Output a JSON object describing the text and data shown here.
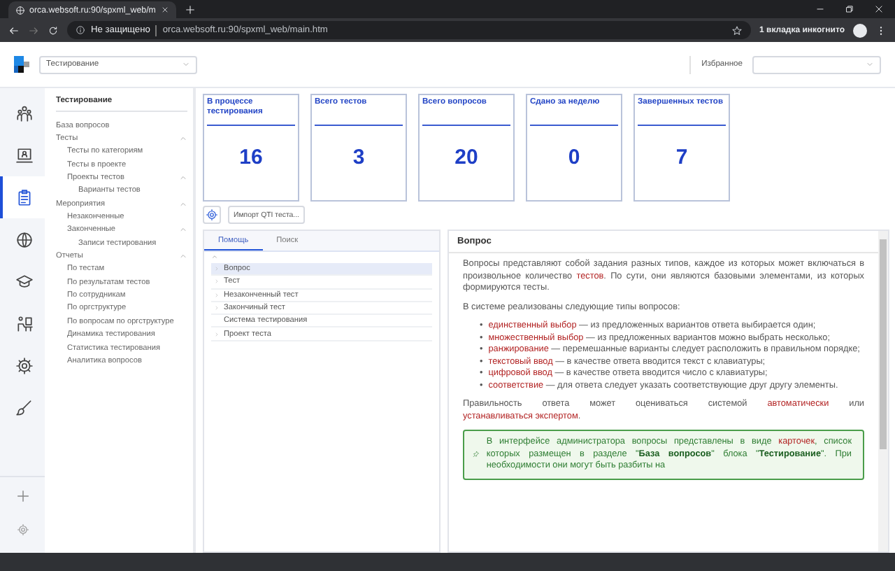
{
  "browser": {
    "tab_title": "orca.websoft.ru:90/spxml_web/m",
    "security": "Не защищено",
    "url": "orca.websoft.ru:90/spxml_web/main.htm",
    "incognito": "1 вкладка инкогнито"
  },
  "header": {
    "section_select": "Тестирование",
    "favorites_label": "Избранное"
  },
  "rail": [
    {
      "selected": false
    },
    {
      "selected": false
    },
    {
      "selected": true
    },
    {
      "selected": false
    },
    {
      "selected": false
    },
    {
      "selected": false
    },
    {
      "selected": false
    },
    {
      "selected": false
    }
  ],
  "nav": {
    "title": "Тестирование",
    "items": [
      {
        "label": "База вопросов"
      },
      {
        "label": "Тесты",
        "expanded": true,
        "children": [
          {
            "label": "Тесты по категориям"
          },
          {
            "label": "Тесты в проекте"
          },
          {
            "label": "Проекты тестов",
            "expanded": true,
            "children": [
              {
                "label": "Варианты тестов"
              }
            ]
          }
        ]
      },
      {
        "label": "Мероприятия",
        "expanded": true,
        "children": [
          {
            "label": "Незаконченные"
          },
          {
            "label": "Законченные",
            "expanded": true,
            "children": [
              {
                "label": "Записи тестирования"
              }
            ]
          }
        ]
      },
      {
        "label": "Отчеты",
        "expanded": true,
        "children": [
          {
            "label": "По тестам"
          },
          {
            "label": "По результатам тестов"
          },
          {
            "label": "По сотрудникам"
          },
          {
            "label": "По оргструктуре"
          },
          {
            "label": "По вопросам по оргструктуре"
          },
          {
            "label": "Динамика тестирования"
          },
          {
            "label": "Статистика тестирования"
          },
          {
            "label": "Аналитика вопросов"
          }
        ]
      }
    ]
  },
  "stats": [
    {
      "title": "В процессе тестирования",
      "value": "16"
    },
    {
      "title": "Всего тестов",
      "value": "3"
    },
    {
      "title": "Всего вопросов",
      "value": "20"
    },
    {
      "title": "Сдано за неделю",
      "value": "0"
    },
    {
      "title": "Завершенных тестов",
      "value": "7"
    }
  ],
  "toolbar": {
    "import_button": "Импорт QTI теста..."
  },
  "left_panel": {
    "tabs": [
      {
        "label": "Помощь",
        "selected": true
      },
      {
        "label": "Поиск",
        "selected": false
      }
    ],
    "tree": [
      {
        "label": "Вопрос",
        "selected": true,
        "expandable": true
      },
      {
        "label": "Тест",
        "selected": false,
        "expandable": true
      },
      {
        "label": "Незаконченный тест",
        "selected": false,
        "expandable": true
      },
      {
        "label": "Закончиный тест",
        "selected": false,
        "expandable": true
      },
      {
        "label": "Система тестирования",
        "selected": false,
        "expandable": false
      },
      {
        "label": "Проект теста",
        "selected": false,
        "expandable": true
      }
    ]
  },
  "help": {
    "title": "Вопрос",
    "intro": [
      {
        "text": "Вопросы представляют собой задания разных типов, каждое из которых может включаться в произвольное количество ",
        "link": false
      },
      {
        "text": "тестов",
        "link": true
      },
      {
        "text": ". По сути, они являются базовыми элементами, из которых формируются тесты.",
        "link": false
      }
    ],
    "types_intro": "В системе реализованы следующие типы вопросов:",
    "types": [
      {
        "marker": "•",
        "term": "единственный выбор",
        "description": " — из предложенных вариантов ответа выбирается один;"
      },
      {
        "marker": "•",
        "term": "множественный выбор",
        "description": " — из предложенных вариантов можно выбрать несколько;"
      },
      {
        "marker": "•",
        "term": "ранжирование",
        "description": " — перемешанные варианты следует расположить в правильном порядке;"
      },
      {
        "marker": "•",
        "term": "текстовый ввод",
        "description": " — в качестве ответа вводится текст с клавиатуры;"
      },
      {
        "marker": "•",
        "term": "цифровой ввод",
        "description": " — в качестве ответа вводится число с клавиатуры;"
      },
      {
        "marker": "•",
        "term": "соответствие",
        "description": " — для ответа следует указать соответствующие друг другу элементы."
      }
    ],
    "correctness": [
      {
        "text": "Правильность ответа может оцениваться системой ",
        "link": false
      },
      {
        "text": "автоматически",
        "link": true
      },
      {
        "text": " или ",
        "link": false
      },
      {
        "text": "устанавливаться экспертом",
        "link": true
      },
      {
        "text": ".",
        "link": false
      }
    ],
    "note": [
      {
        "text": "В интерфейсе администратора вопросы представлены в виде ",
        "link": false
      },
      {
        "text": "карточек",
        "link": true
      },
      {
        "text": ", список которых размещен в разделе \"**База вопросов**\" блока \"**Тестирование**\". При необходимости они могут быть разбиты на",
        "link": false
      }
    ]
  }
}
